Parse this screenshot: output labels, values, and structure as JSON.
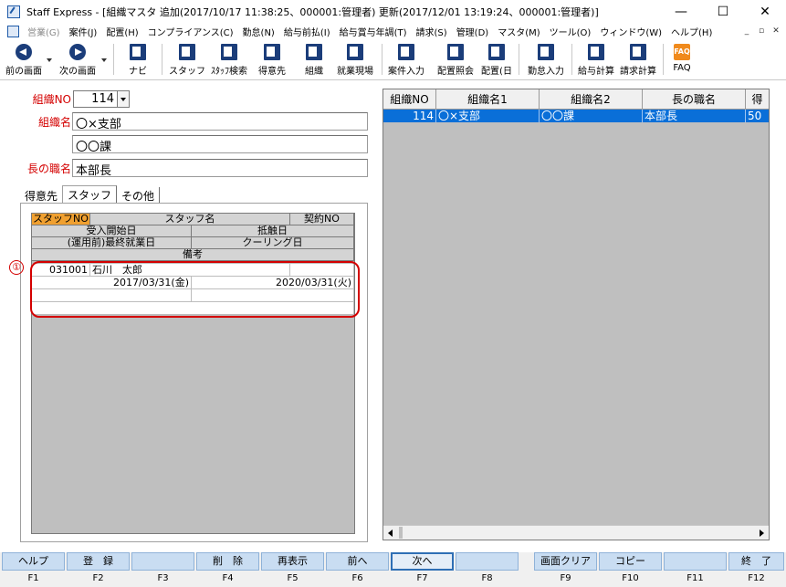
{
  "window": {
    "title": "Staff Express - [組織マスタ 追加(2017/10/17 11:38:25、000001:管理者) 更新(2017/12/01 13:19:24、000001:管理者)]",
    "minimize": "—",
    "maximize": "☐",
    "close": "✕"
  },
  "menu": {
    "items": [
      {
        "label": "営業(G)",
        "disabled": true
      },
      {
        "label": "案件(J)"
      },
      {
        "label": "配置(H)"
      },
      {
        "label": "コンプライアンス(C)"
      },
      {
        "label": "勤怠(N)"
      },
      {
        "label": "給与前払(I)"
      },
      {
        "label": "給与賞与年調(T)"
      },
      {
        "label": "請求(S)"
      },
      {
        "label": "管理(D)"
      },
      {
        "label": "マスタ(M)"
      },
      {
        "label": "ツール(O)"
      },
      {
        "label": "ウィンドウ(W)"
      },
      {
        "label": "ヘルプ(H)"
      }
    ],
    "mdi": [
      "_",
      "▫",
      "✕"
    ]
  },
  "toolbar": {
    "prev": "前の画面",
    "next": "次の画面",
    "navi": "ナビ",
    "staff": "スタッフ",
    "staff_search": "ｽﾀｯﾌ検索",
    "client": "得意先",
    "org": "組織",
    "site": "就業現場",
    "case_input": "案件入力",
    "placement_inquiry": "配置照会",
    "placement_day": "配置(日",
    "attendance_input": "勤怠入力",
    "payroll_calc": "給与計算",
    "billing_calc": "請求計算",
    "faq": "FAQ",
    "faq_icon_text": "FAQ"
  },
  "form": {
    "org_no_label": "組織NO",
    "org_no_value": "114",
    "org_name_label": "組織名",
    "org_name1": "〇×支部",
    "org_name2": "〇〇課",
    "head_title_label": "長の職名",
    "head_title_value": "本部長"
  },
  "tabs": [
    {
      "label": "得意先"
    },
    {
      "label": "スタッフ",
      "active": true
    },
    {
      "label": "その他"
    }
  ],
  "staff_grid": {
    "headers": {
      "staff_no": "スタッフNO",
      "staff_name": "スタッフ名",
      "contract_no": "契約NO",
      "accept_start": "受入開始日",
      "conflict_date": "抵触日",
      "last_work": "(運用前)最終就業日",
      "cooling": "クーリング日",
      "remarks": "備考"
    },
    "row": {
      "staff_no": "031001",
      "staff_name": "石川　太郎",
      "contract_no": "",
      "accept_start": "2017/03/31(金)",
      "conflict_date": "2020/03/31(火)"
    },
    "annotation": "①"
  },
  "org_list": {
    "headers": [
      "組織NO",
      "組織名1",
      "組織名2",
      "長の職名",
      "得"
    ],
    "rows": [
      {
        "no": "114",
        "name1": "〇×支部",
        "name2": "〇〇課",
        "head": "本部長",
        "extra": "50"
      }
    ]
  },
  "fkeys": [
    {
      "label": "ヘルプ",
      "key": "F1"
    },
    {
      "label": "登　録",
      "key": "F2"
    },
    {
      "label": "",
      "key": "F3"
    },
    {
      "label": "削　除",
      "key": "F4"
    },
    {
      "label": "再表示",
      "key": "F5"
    },
    {
      "label": "前へ",
      "key": "F6"
    },
    {
      "label": "次へ",
      "key": "F7",
      "focus": true
    },
    {
      "label": "",
      "key": "F8"
    },
    {
      "label": "画面クリア",
      "key": "F9"
    },
    {
      "label": "コピー",
      "key": "F10"
    },
    {
      "label": "",
      "key": "F11"
    },
    {
      "label": "終　了",
      "key": "F12"
    }
  ]
}
